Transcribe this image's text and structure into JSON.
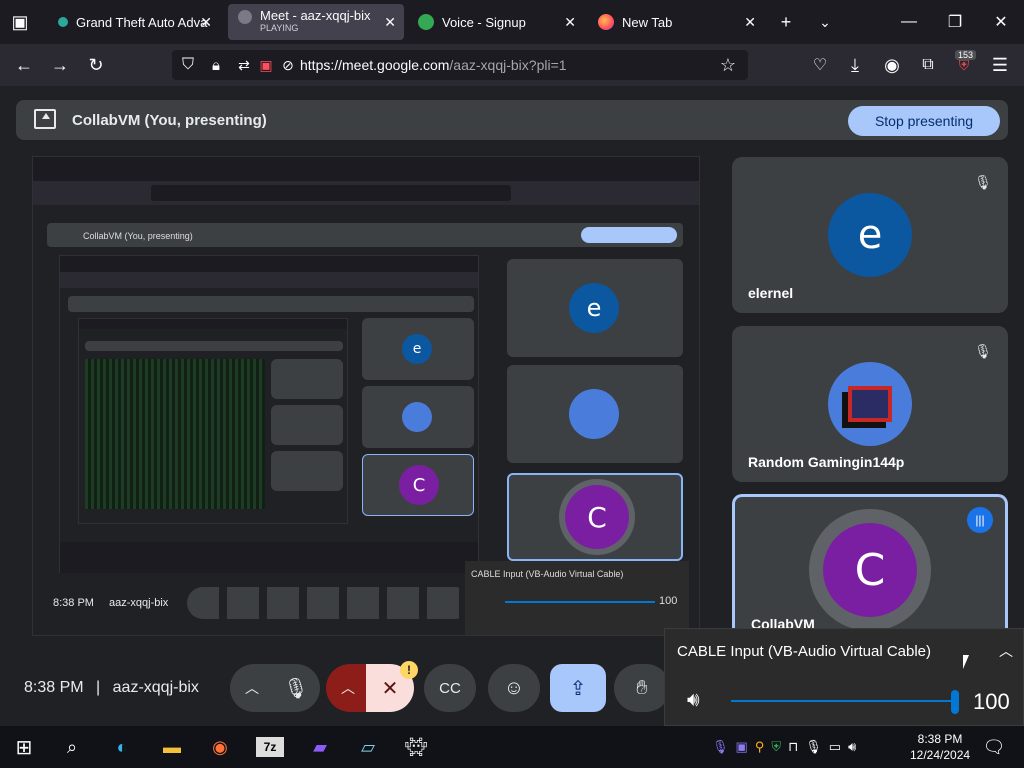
{
  "browser": {
    "tabs": [
      {
        "label": "Grand Theft Auto Adva",
        "active": false
      },
      {
        "label": "Meet - aaz-xqqj-bix",
        "sublabel": "PLAYING",
        "active": true
      },
      {
        "label": "Voice - Signup",
        "active": false
      },
      {
        "label": "New Tab",
        "active": false
      }
    ],
    "url_main": "https://meet.google.com",
    "url_rest": "/aaz-xqqj-bix?pli=1",
    "notification_badge": "153"
  },
  "meet": {
    "presenting_label": "CollabVM (You, presenting)",
    "stop_presenting": "Stop presenting",
    "participants": [
      {
        "name": "elernel",
        "initial": "e",
        "avatar_color": "#0b57a0",
        "muted": true
      },
      {
        "name": "Random Gamingin144p",
        "initial": "",
        "avatar_color": "#4a7cdb",
        "muted": true
      },
      {
        "name": "CollabVM",
        "initial": "C",
        "avatar_color": "#7b1fa2",
        "speaking": true
      }
    ],
    "clock": "8:38 PM",
    "separator": "|",
    "meeting_code": "aaz-xqqj-bix",
    "camera_alert": "!"
  },
  "audio_popup": {
    "title": "CABLE Input (VB-Audio Virtual Cable)",
    "volume": "100",
    "volume_level": 1.0
  },
  "taskbar": {
    "time": "8:38 PM",
    "date": "12/24/2024"
  }
}
